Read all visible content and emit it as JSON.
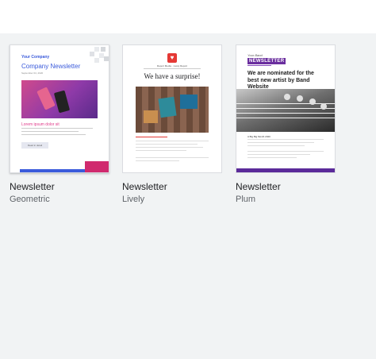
{
  "templates": [
    {
      "title": "Newsletter",
      "subtitle": "Geometric",
      "preview": {
        "company": "Your Company",
        "heading": "Company Newsletter",
        "date": "September 04, 2020",
        "section": "Lorem ipsum dolor sit",
        "button": "Read in detail",
        "accent": "#3b5bdb",
        "accent2": "#d02a6e"
      }
    },
    {
      "title": "Newsletter",
      "subtitle": "Lively",
      "preview": {
        "brand": "Report Media · Lively Report",
        "heading": "We have a surprise!",
        "accent": "#e53935"
      }
    },
    {
      "title": "Newsletter",
      "subtitle": "Plum",
      "preview": {
        "brand": "Your Band",
        "label": "NEWSLETTER",
        "heading": "We are nominated for the best new artist by Band Website",
        "small": "A Big Big Month 2020",
        "accent": "#5b2a9a"
      }
    }
  ]
}
